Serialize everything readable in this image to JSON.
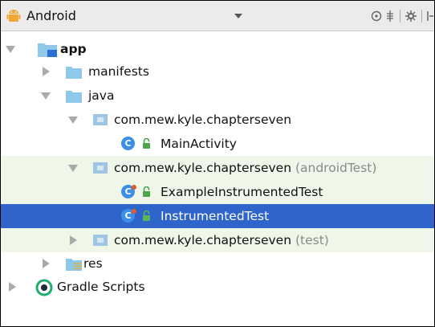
{
  "toolbar": {
    "view_label": "Android",
    "icons": [
      "android-icon",
      "dropdown-arrow-icon",
      "scope-icon",
      "collapse-icon",
      "settings-icon",
      "hide-icon"
    ]
  },
  "tree": {
    "app": "app",
    "manifests": "manifests",
    "java": "java",
    "pkg_main": "com.mew.kyle.chapterseven",
    "main_activity": "MainActivity",
    "pkg_android_test": "com.mew.kyle.chapterseven",
    "pkg_android_test_suffix": "(androidTest)",
    "example_instrumented_test": "ExampleInstrumentedTest",
    "instrumented_test": "InstrumentedTest",
    "pkg_test": "com.mew.kyle.chapterseven",
    "pkg_test_suffix": "(test)",
    "res": "res",
    "gradle_scripts": "Gradle Scripts"
  },
  "class_badge_letter": "C",
  "selected_item": "InstrumentedTest",
  "colors": {
    "toolbar_bg": "#ebebeb",
    "selection": "#2f65ca",
    "test_group_bg": "#eef7e8",
    "folder": "#8fc8e9",
    "class_badge": "#3d8ee6",
    "lock": "#4aa44a"
  }
}
